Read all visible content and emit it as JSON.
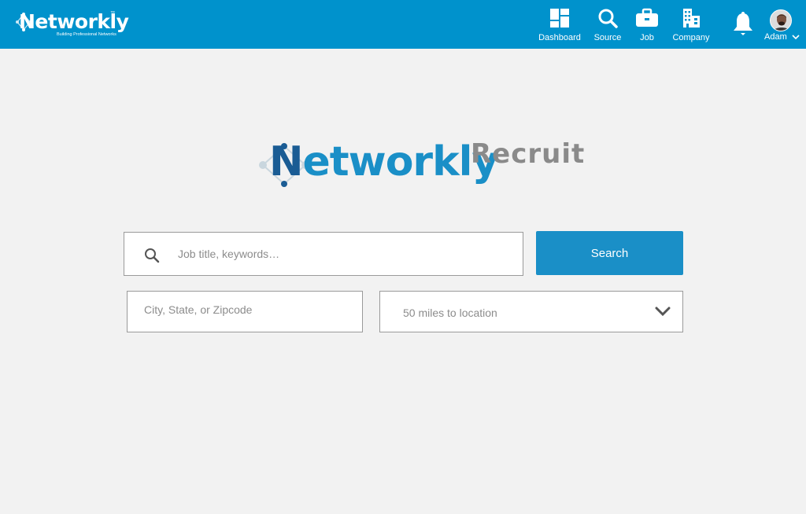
{
  "header": {
    "brand": {
      "name": "Networkly",
      "tm": "™",
      "tagline": "Building Professional Networks"
    },
    "nav": [
      {
        "label": "Dashboard",
        "icon": "dashboard-icon"
      },
      {
        "label": "Source",
        "icon": "search-icon"
      },
      {
        "label": "Job",
        "icon": "briefcase-icon"
      },
      {
        "label": "Company",
        "icon": "building-icon"
      }
    ],
    "notifications_icon": "bell-icon",
    "user": {
      "name": "Adam",
      "icon": "chevron-down-icon"
    },
    "background_color": "#0092cc"
  },
  "hero": {
    "logo_word": "Networkly",
    "logo_first": "N",
    "logo_rest": "etworkly",
    "logo_suffix": "Recruit"
  },
  "search": {
    "keyword_placeholder": "Job title, keywords…",
    "keyword_value": "",
    "search_button": "Search",
    "location_placeholder": "City, State, or Zipcode",
    "location_value": "",
    "radius_selected": "50 miles to location",
    "accent_color": "#1a8fc7"
  }
}
